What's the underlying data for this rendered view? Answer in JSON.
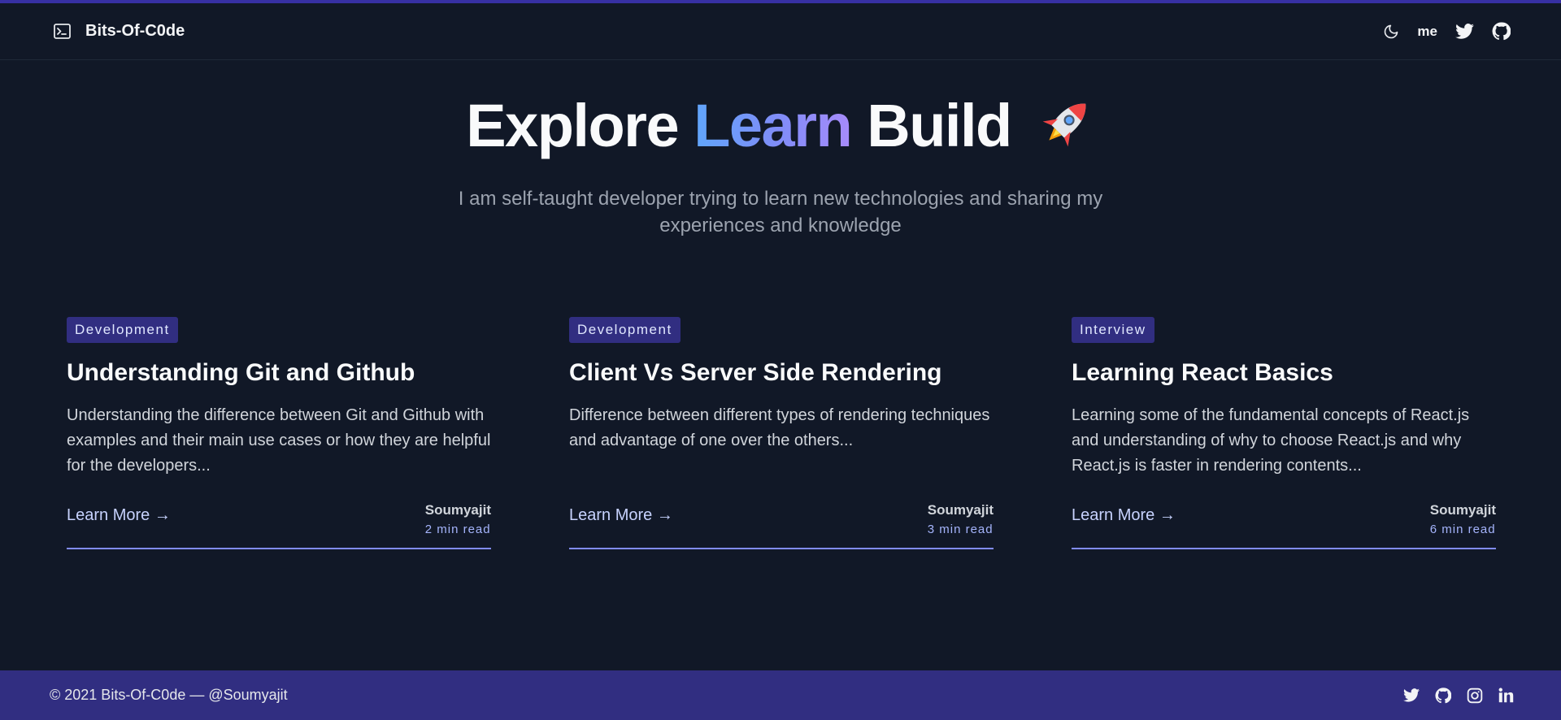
{
  "brand": {
    "name": "Bits-Of-C0de",
    "icon": "terminal-icon"
  },
  "nav": {
    "me_label": "me",
    "icons": [
      "moon-icon",
      "twitter-icon",
      "github-icon"
    ]
  },
  "hero": {
    "title_part1": "Explore",
    "title_highlight": "Learn",
    "title_part2": "Build",
    "emoji": "rocket",
    "subtitle": "I am self-taught developer trying to learn new technologies and sharing my experiences and knowledge"
  },
  "posts": [
    {
      "category": "Development",
      "title": "Understanding Git and Github",
      "description": "Understanding the difference between Git and Github with examples and their main use cases or how they are helpful for the developers...",
      "cta": "Learn More →",
      "author": "Soumyajit",
      "read_time": "2 min read"
    },
    {
      "category": "Development",
      "title": "Client Vs Server Side Rendering",
      "description": "Difference between different types of rendering techniques and advantage of one over the others...",
      "cta": "Learn More →",
      "author": "Soumyajit",
      "read_time": "3 min read"
    },
    {
      "category": "Interview",
      "title": "Learning React Basics",
      "description": "Learning some of the fundamental concepts of React.js and understanding of why to choose React.js and why React.js is faster in rendering contents...",
      "cta": "Learn More →",
      "author": "Soumyajit",
      "read_time": "6 min read"
    }
  ],
  "footer": {
    "copyright": "© 2021 Bits-Of-C0de — @Soumyajit",
    "icons": [
      "twitter-icon",
      "github-icon",
      "instagram-icon",
      "linkedin-icon"
    ]
  },
  "colors": {
    "background": "#111827",
    "accent": "#312e81",
    "gradient_start": "#60a5fa",
    "gradient_end": "#a78bfa",
    "card_underline": "#818cf8"
  }
}
